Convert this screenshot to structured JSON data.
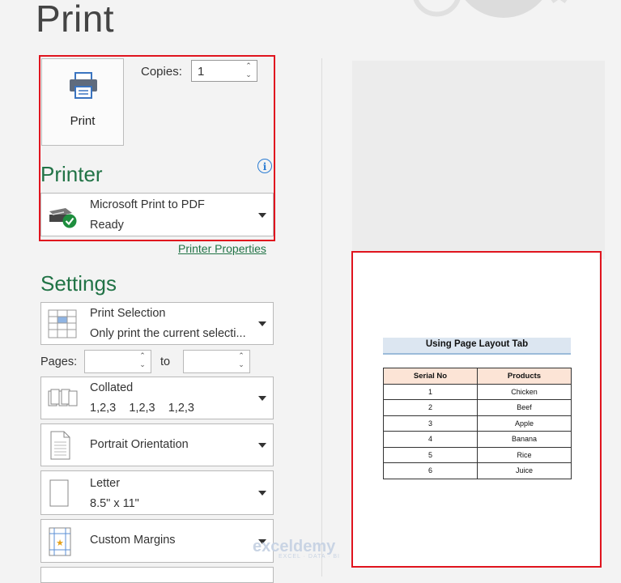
{
  "page_title": "Print",
  "print_button": {
    "label": "Print",
    "icon": "printer-icon"
  },
  "copies": {
    "label": "Copies:",
    "value": "1"
  },
  "printer": {
    "section_title": "Printer",
    "name": "Microsoft Print to PDF",
    "status": "Ready",
    "properties_link": "Printer Properties"
  },
  "settings": {
    "section_title": "Settings",
    "print_what": {
      "title": "Print Selection",
      "subtitle": "Only print the current selecti..."
    },
    "pages": {
      "label": "Pages:",
      "to_label": "to",
      "from_value": "",
      "to_value": ""
    },
    "collation": {
      "title": "Collated",
      "subtitle": "1,2,3    1,2,3    1,2,3"
    },
    "orientation": {
      "title": "Portrait Orientation"
    },
    "paper": {
      "title": "Letter",
      "subtitle": "8.5\" x 11\""
    },
    "margins": {
      "title": "Custom Margins"
    }
  },
  "preview": {
    "sheet_title": "Using Page Layout Tab",
    "headers": [
      "Serial No",
      "Products"
    ],
    "rows": [
      [
        "1",
        "Chicken"
      ],
      [
        "2",
        "Beef"
      ],
      [
        "3",
        "Apple"
      ],
      [
        "4",
        "Banana"
      ],
      [
        "5",
        "Rice"
      ],
      [
        "6",
        "Juice"
      ]
    ]
  },
  "watermark": {
    "name": "exceldemy",
    "tagline": "EXCEL · DATA · BI"
  },
  "colors": {
    "accent_green": "#217346",
    "highlight_red": "#e0141e",
    "info_blue": "#2b7cd3"
  }
}
